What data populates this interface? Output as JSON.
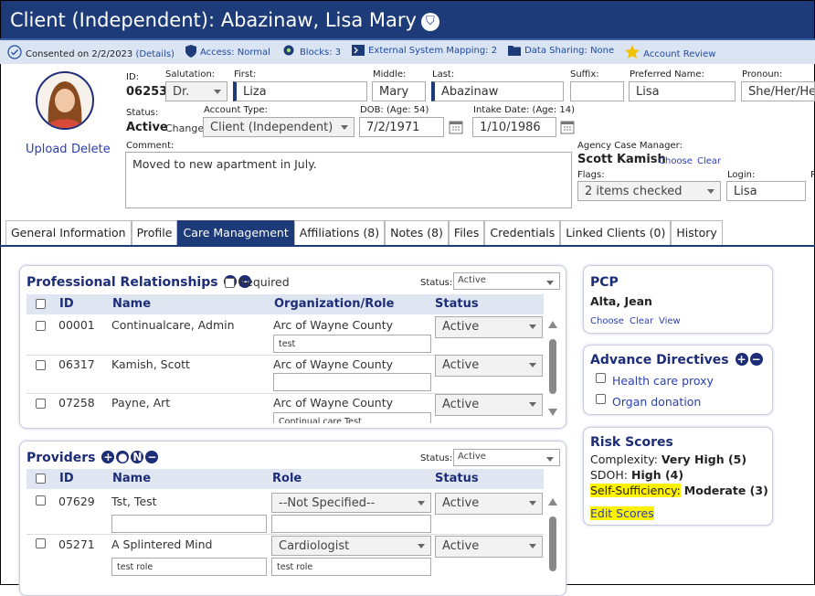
{
  "header": {
    "title": "Client (Independent): Abazinaw, Lisa Mary"
  },
  "status_bar": {
    "consented": "Consented on 2/2/2023",
    "details": "(Details)",
    "access": "Access: Normal",
    "blocks": "Blocks: 3",
    "mapping": "External System Mapping: 2",
    "sharing": "Data Sharing: None",
    "review": "Account Review"
  },
  "client": {
    "upload": "Upload",
    "delete": "Delete",
    "id_label": "ID:",
    "id": "06253",
    "salutation_label": "Salutation:",
    "salutation": "Dr.",
    "first_label": "First:",
    "first": "Liza",
    "middle_label": "Middle:",
    "middle": "Mary",
    "last_label": "Last:",
    "last": "Abazinaw",
    "suffix_label": "Suffix:",
    "suffix": "",
    "preferred_label": "Preferred Name:",
    "preferred": "Lisa",
    "pronoun_label": "Pronoun:",
    "pronoun": "She/Her/Hers",
    "status_label": "Status:",
    "status": "Active",
    "change": "Change",
    "account_type_label": "Account Type:",
    "account_type": "Client (Independent)",
    "dob_label": "DOB: (Age: 54)",
    "dob": "7/2/1971",
    "intake_label": "Intake Date: (Age: 14)",
    "intake": "1/10/1986",
    "comment_label": "Comment:",
    "comment": "Moved to new apartment in July.",
    "manager_label": "Agency Case Manager:",
    "manager": "Scott Kamish",
    "choose": "Choose",
    "clear": "Clear",
    "flags_label": "Flags:",
    "flags": "2 items checked",
    "login_label": "Login:",
    "login": "Lisa",
    "extra_label": "P"
  },
  "tabs": [
    "General Information",
    "Profile",
    "Care Management",
    "Affiliations (8)",
    "Notes (8)",
    "Files",
    "Credentials",
    "Linked Clients (0)",
    "History"
  ],
  "prof": {
    "title": "Professional Relationships",
    "required": "Required",
    "status_label": "Status:",
    "status_value": "Active",
    "headers": {
      "id": "ID",
      "name": "Name",
      "org": "Organization/Role",
      "status": "Status"
    },
    "rows": [
      {
        "id": "00001",
        "name": "Continualcare, Admin",
        "org": "Arc of Wayne County",
        "note": "test",
        "status": "Active"
      },
      {
        "id": "06317",
        "name": "Kamish, Scott",
        "org": "Arc of Wayne County",
        "note": "",
        "status": "Active"
      },
      {
        "id": "07258",
        "name": "Payne, Art",
        "org": "Arc of Wayne County",
        "note": "Continual care Test",
        "status": "Active"
      }
    ]
  },
  "providers": {
    "title": "Providers",
    "status_label": "Status:",
    "status_value": "Active",
    "headers": {
      "id": "ID",
      "name": "Name",
      "role": "Role",
      "status": "Status"
    },
    "rows": [
      {
        "id": "07629",
        "name": "Tst, Test",
        "role": "--Not Specified--",
        "note": "",
        "status": "Active"
      },
      {
        "id": "05271",
        "name": "A Splintered Mind",
        "role": "Cardiologist",
        "note": "test role",
        "status": "Active"
      }
    ]
  },
  "pcp": {
    "title": "PCP",
    "name": "Alta, Jean",
    "choose": "Choose",
    "clear": "Clear",
    "view": "View"
  },
  "advance": {
    "title": "Advance Directives",
    "items": [
      "Health care proxy",
      "Organ donation"
    ]
  },
  "risk": {
    "title": "Risk Scores",
    "complexity_label": "Complexity:",
    "complexity": "Very High (5)",
    "sdoh_label": "SDOH:",
    "sdoh": "High (4)",
    "self_label": "Self-Sufficiency:",
    "self": "Moderate (3)",
    "edit": "Edit Scores"
  }
}
